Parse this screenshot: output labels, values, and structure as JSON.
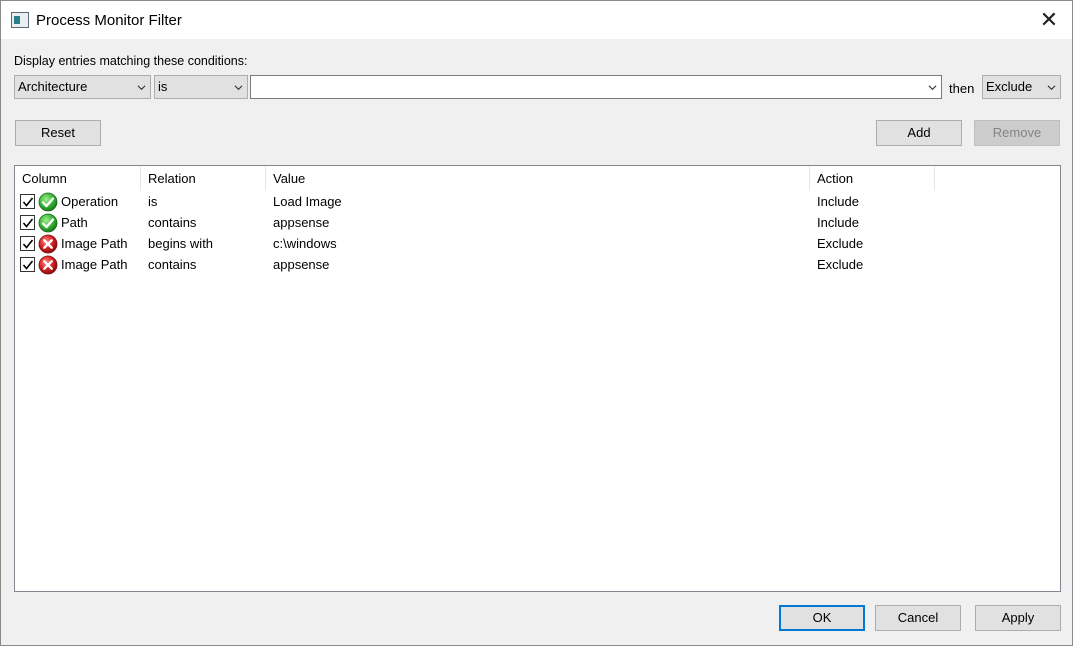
{
  "window": {
    "title": "Process Monitor Filter",
    "close_glyph": "✕"
  },
  "conditions_label": "Display entries matching these conditions:",
  "filter": {
    "column_value": "Architecture",
    "relation_value": "is",
    "value_value": "",
    "then_label": "then",
    "action_value": "Exclude"
  },
  "buttons": {
    "reset": "Reset",
    "add": "Add",
    "remove": "Remove",
    "ok": "OK",
    "cancel": "Cancel",
    "apply": "Apply"
  },
  "list": {
    "headers": [
      "Column",
      "Relation",
      "Value",
      "Action"
    ],
    "rows": [
      {
        "checked": true,
        "icon": "include-check-icon",
        "column": "Operation",
        "relation": "is",
        "value": "Load Image",
        "action": "Include"
      },
      {
        "checked": true,
        "icon": "include-check-icon",
        "column": "Path",
        "relation": "contains",
        "value": "appsense",
        "action": "Include"
      },
      {
        "checked": true,
        "icon": "exclude-x-icon",
        "column": "Image Path",
        "relation": "begins with",
        "value": "c:\\windows",
        "action": "Exclude"
      },
      {
        "checked": true,
        "icon": "exclude-x-icon",
        "column": "Image Path",
        "relation": "contains",
        "value": "appsense",
        "action": "Exclude"
      }
    ]
  },
  "colors": {
    "include": "#2fa82f",
    "exclude": "#d42020",
    "focus": "#0078d7"
  }
}
